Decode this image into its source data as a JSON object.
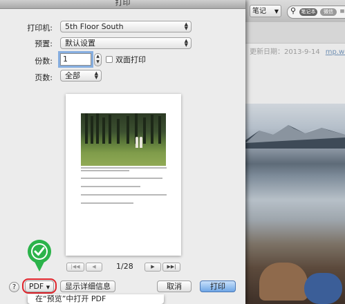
{
  "dialog": {
    "title": "打印"
  },
  "printer": {
    "label": "打印机:",
    "value": "5th Floor South"
  },
  "presets": {
    "label": "预置:",
    "value": "默认设置"
  },
  "copies": {
    "label": "份数:",
    "value": "1",
    "duplex_label": "双面打印",
    "duplex_checked": false
  },
  "pages": {
    "label": "页数:",
    "value": "全部"
  },
  "pager": {
    "indicator": "1/28"
  },
  "buttons": {
    "help": "?",
    "pdf": "PDF",
    "show_details": "显示详细信息",
    "cancel": "取消",
    "print": "打印"
  },
  "pdf_menu": {
    "first_item": "在“预览”中打开 PDF"
  },
  "background_app": {
    "notebook_button": "笔记",
    "search_chips": [
      "笔记本",
      "微信",
      "≡"
    ],
    "updated": "更新日期：2013-9-14",
    "link": "mp.weixin"
  },
  "icons": [
    "stepper-arrows-icon",
    "first-page-icon",
    "prev-page-icon",
    "next-page-icon",
    "last-page-icon",
    "green-check-callout-icon",
    "search-icon"
  ],
  "colors": {
    "callout_green": "#2bb34a",
    "highlight_ring": "#e0242b",
    "print_button": "#6fa6e6"
  }
}
